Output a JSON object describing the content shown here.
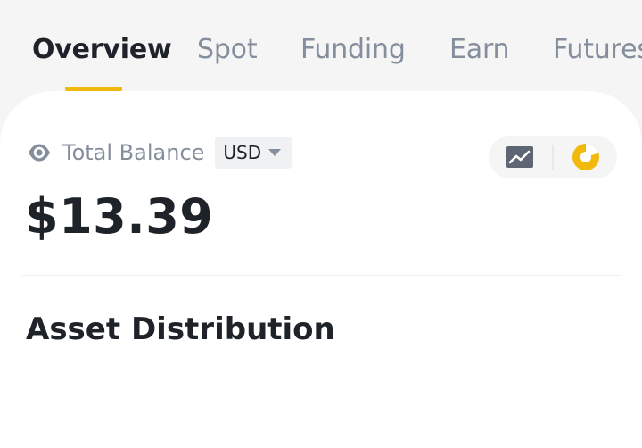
{
  "tabs": [
    {
      "label": "Overview",
      "active": true
    },
    {
      "label": "Spot",
      "active": false
    },
    {
      "label": "Funding",
      "active": false
    },
    {
      "label": "Earn",
      "active": false
    },
    {
      "label": "Futures",
      "active": false
    }
  ],
  "balance": {
    "label": "Total Balance",
    "currency": "USD",
    "value": "$13.39"
  },
  "section": {
    "title": "Asset Distribution"
  },
  "icons": {
    "visibility": "eye-icon",
    "currency_dropdown": "chevron-down-icon",
    "chart": "line-chart-icon",
    "distribution": "pie-chart-icon"
  },
  "colors": {
    "accent": "#f0b90b",
    "text_primary": "#1e2329",
    "text_secondary": "#848e9c",
    "background": "#f5f5f5",
    "card": "#ffffff"
  }
}
